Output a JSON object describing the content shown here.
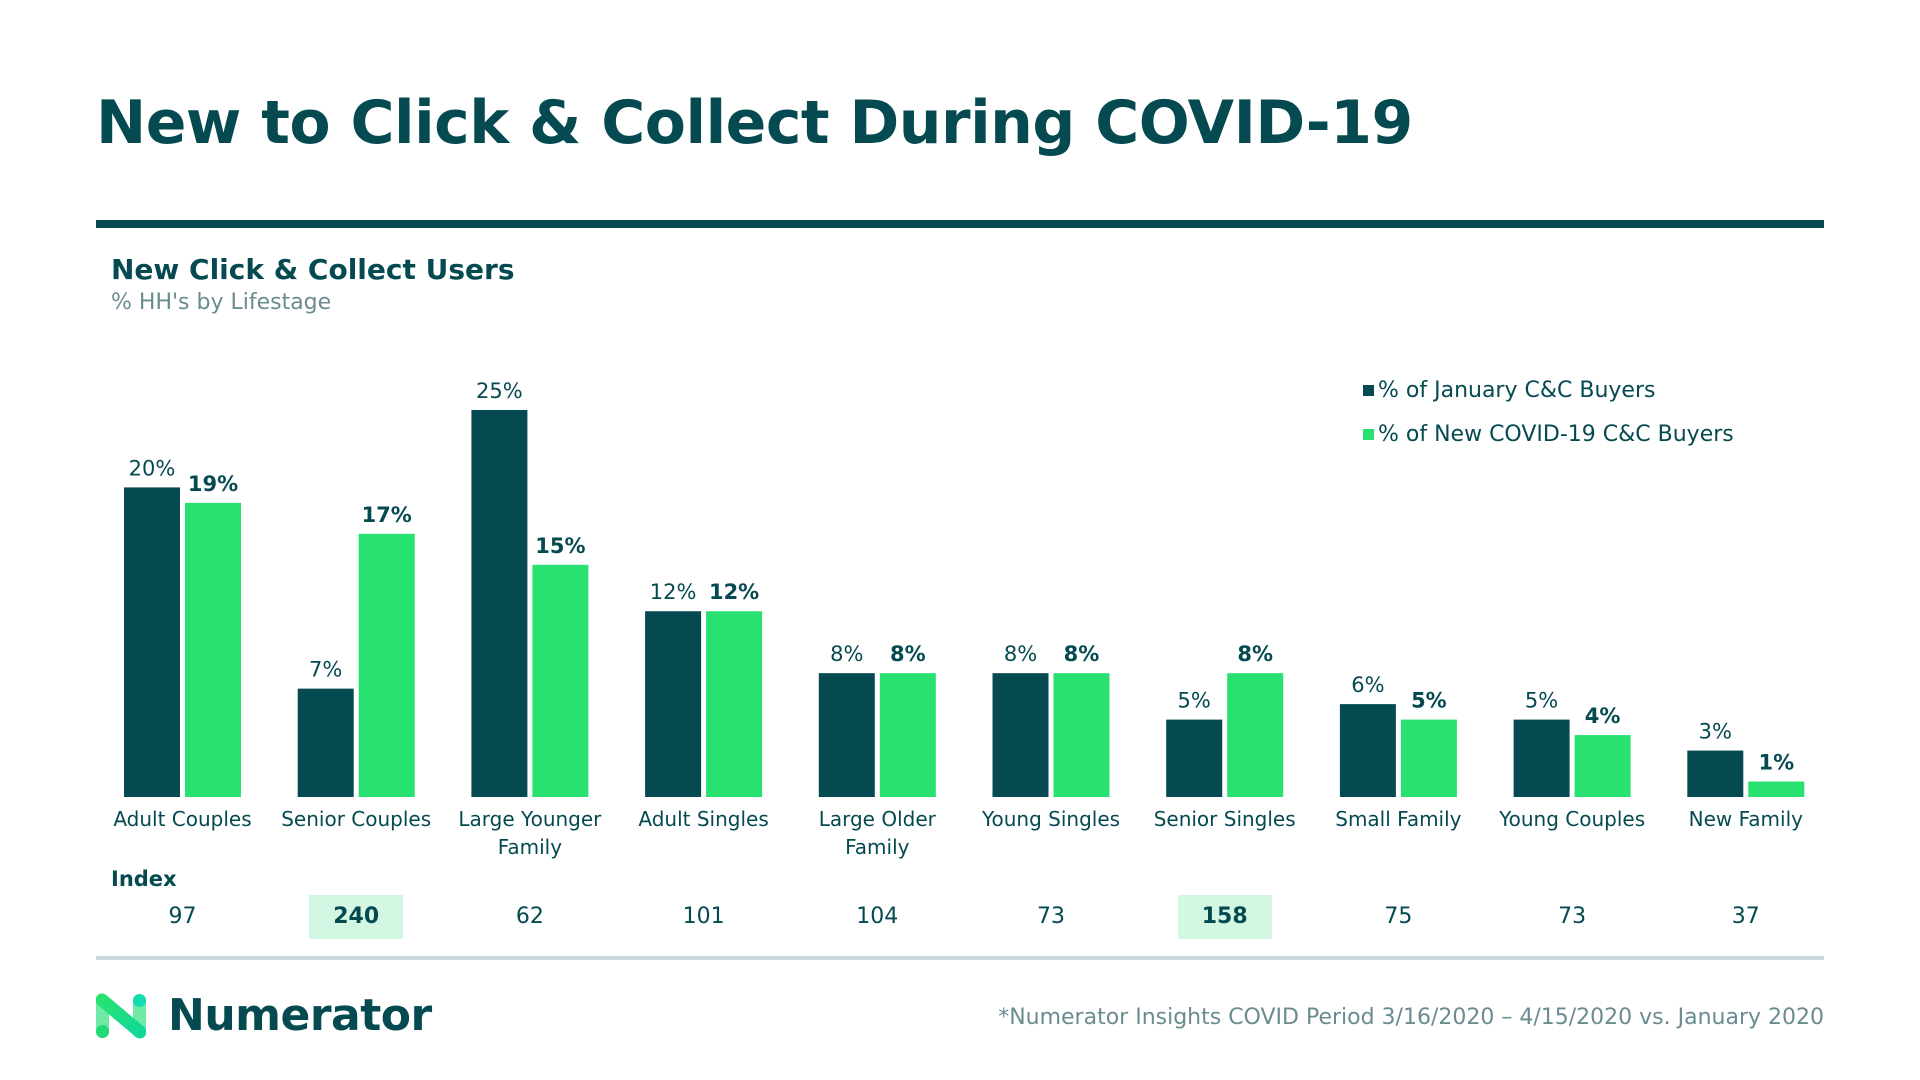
{
  "title": "New to Click & Collect During COVID-19",
  "chart_heading": "New Click & Collect Users",
  "chart_subheading": "% HH's by Lifestage",
  "colors": {
    "primary": "#054a50",
    "accent": "#27e270",
    "highlight": "#d3f7e3",
    "muted": "#6a8c90",
    "divider": "#c8d8da"
  },
  "index_label": "Index",
  "footnote": "*Numerator Insights COVID Period 3/16/2020 – 4/15/2020 vs. January 2020",
  "logo": {
    "text": "Numerator",
    "icon": "numerator-n-logo-icon"
  },
  "chart_data": {
    "type": "bar",
    "title": "New Click & Collect Users",
    "subtitle": "% HH's by Lifestage",
    "xlabel": "",
    "ylabel": "% HH's",
    "ylim": [
      0,
      25
    ],
    "grid": false,
    "legend_position": "top-right",
    "categories": [
      "Adult Couples",
      "Senior Couples",
      "Large Younger Family",
      "Adult Singles",
      "Large Older Family",
      "Young Singles",
      "Senior Singles",
      "Small Family",
      "Young Couples",
      "New Family"
    ],
    "category_lines": [
      [
        "Adult Couples"
      ],
      [
        "Senior Couples"
      ],
      [
        "Large Younger",
        "Family"
      ],
      [
        "Adult Singles"
      ],
      [
        "Large Older",
        "Family"
      ],
      [
        "Young Singles"
      ],
      [
        "Senior Singles"
      ],
      [
        "Small Family"
      ],
      [
        "Young Couples"
      ],
      [
        "New Family"
      ]
    ],
    "series": [
      {
        "name": "% of January C&C Buyers",
        "color": "#054a50",
        "values": [
          20,
          7,
          25,
          12,
          8,
          8,
          5,
          6,
          5,
          3
        ],
        "labels": [
          "20%",
          "7%",
          "25%",
          "12%",
          "8%",
          "8%",
          "5%",
          "6%",
          "5%",
          "3%"
        ],
        "label_bold": false
      },
      {
        "name": "% of New COVID-19 C&C Buyers",
        "color": "#27e270",
        "values": [
          19,
          17,
          15,
          12,
          8,
          8,
          8,
          5,
          4,
          1
        ],
        "labels": [
          "19%",
          "17%",
          "15%",
          "12%",
          "8%",
          "8%",
          "8%",
          "5%",
          "4%",
          "1%"
        ],
        "label_bold": true
      }
    ],
    "index": {
      "label": "Index",
      "values": [
        97,
        240,
        62,
        101,
        104,
        73,
        158,
        75,
        73,
        37
      ],
      "highlighted": [
        false,
        true,
        false,
        false,
        false,
        false,
        true,
        false,
        false,
        false
      ]
    }
  }
}
